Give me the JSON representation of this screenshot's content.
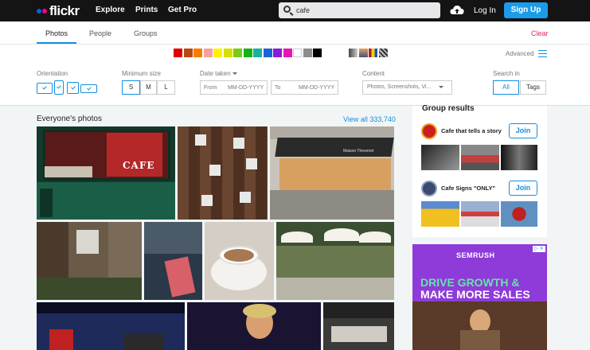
{
  "header": {
    "logo": "flickr",
    "nav": [
      "Explore",
      "Prints",
      "Get Pro"
    ],
    "search_value": "cafe",
    "login": "Log In",
    "signup": "Sign Up"
  },
  "filters": {
    "tabs": [
      "Photos",
      "People",
      "Groups"
    ],
    "clear": "Clear",
    "advanced": "Advanced",
    "colors": [
      "#e00000",
      "#b84a10",
      "#f77c00",
      "#f5a0a0",
      "#fff200",
      "#d6e000",
      "#7acb17",
      "#17b017",
      "#18b0a0",
      "#1b63d6",
      "#8a1cd6",
      "#e417b0",
      "#ffffff",
      "#8c8c8c",
      "#000000"
    ],
    "orientation_label": "Orientation",
    "min_size_label": "Minimum size",
    "sizes": [
      "S",
      "M",
      "L"
    ],
    "date_label": "Date taken",
    "date_from_label": "From",
    "date_from_placeholder": "MM-DD-YYYY",
    "date_to_label": "To",
    "date_to_placeholder": "MM-DD-YYYY",
    "content_label": "Content",
    "content_value": "Photos, Screenshots, Vi...",
    "searchin_label": "Search in",
    "searchin_options": [
      "All",
      "Tags"
    ]
  },
  "main": {
    "title": "Everyone's photos",
    "view_all": "View all 333,740",
    "cafe_sign": "CAFE",
    "awning_text": "Maison Thevenet"
  },
  "groups": {
    "title": "Group results",
    "items": [
      {
        "name": "Cafe that tells a story",
        "join": "Join"
      },
      {
        "name": "Cafe Signs \"ONLY\"",
        "join": "Join"
      }
    ]
  },
  "ad": {
    "brand": "SEMRUSH",
    "line1": "DRIVE GROWTH &",
    "line2": "MAKE MORE SALES"
  }
}
